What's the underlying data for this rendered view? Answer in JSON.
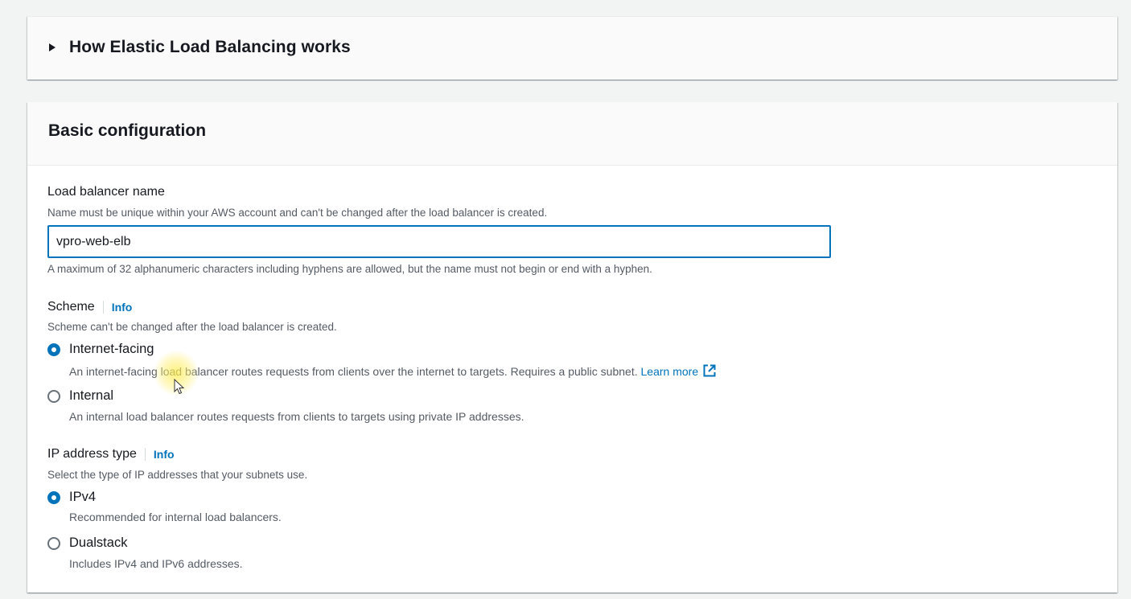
{
  "how_it_works": {
    "title": "How Elastic Load Balancing works"
  },
  "basic_configuration": {
    "title": "Basic configuration",
    "load_balancer_name": {
      "label": "Load balancer name",
      "description": "Name must be unique within your AWS account and can't be changed after the load balancer is created.",
      "value": "vpro-web-elb",
      "constraint": "A maximum of 32 alphanumeric characters including hyphens are allowed, but the name must not begin or end with a hyphen."
    },
    "scheme": {
      "label": "Scheme",
      "info": "Info",
      "description": "Scheme can't be changed after the load balancer is created.",
      "options": [
        {
          "label": "Internet-facing",
          "description": "An internet-facing load balancer routes requests from clients over the internet to targets. Requires a public subnet.",
          "link": "Learn more",
          "selected": true
        },
        {
          "label": "Internal",
          "description": "An internal load balancer routes requests from clients to targets using private IP addresses.",
          "selected": false
        }
      ]
    },
    "ip_address_type": {
      "label": "IP address type",
      "info": "Info",
      "description": "Select the type of IP addresses that your subnets use.",
      "options": [
        {
          "label": "IPv4",
          "description": "Recommended for internal load balancers.",
          "selected": true
        },
        {
          "label": "Dualstack",
          "description": "Includes IPv4 and IPv6 addresses.",
          "selected": false
        }
      ]
    }
  },
  "colors": {
    "link": "#0073bb",
    "selected_radio": "#0073bb",
    "input_focus_border": "#0073bb",
    "text_primary": "#16191f",
    "text_secondary": "#545b64",
    "page_background": "#f2f3f3"
  },
  "icons": {
    "expander": "caret-right-icon",
    "external_link": "external-link-icon"
  }
}
